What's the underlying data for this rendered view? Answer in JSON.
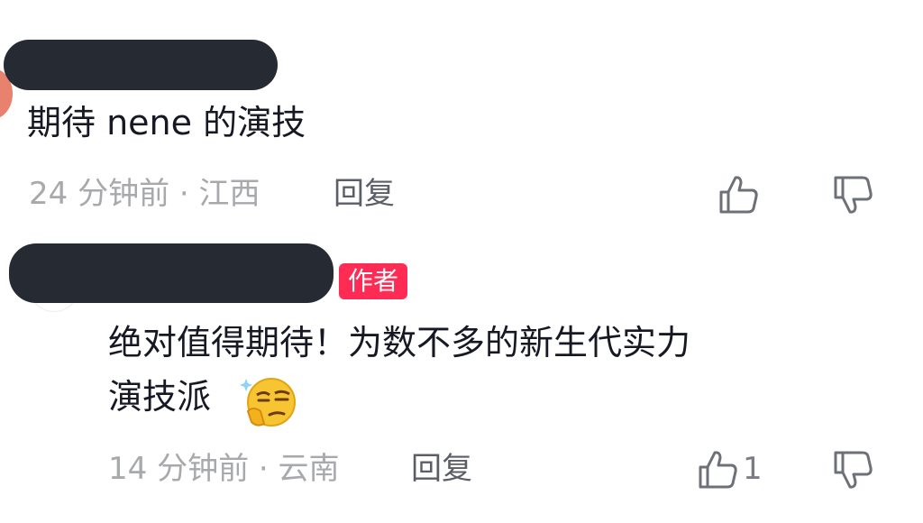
{
  "comments": [
    {
      "text": "期待 nene 的演技",
      "meta": "24 分钟前 · 江西",
      "reply_label": "回复",
      "like_icon": "thumbs-up-icon",
      "dislike_icon": "thumbs-down-icon"
    },
    {
      "author_badge": "作者",
      "text_line1": "绝对值得期待！为数不多的新生代实力",
      "text_line2": "演技派",
      "emoji": "smug-face-emoji",
      "meta": "14 分钟前 · 云南",
      "reply_label": "回复",
      "like_count": "1",
      "like_icon": "thumbs-up-icon",
      "dislike_icon": "thumbs-down-icon"
    }
  ],
  "colors": {
    "redaction": "#252a33",
    "badge": "#fe2c55",
    "meta_text": "#a7a9ad",
    "reply_text": "#5b5e66"
  }
}
